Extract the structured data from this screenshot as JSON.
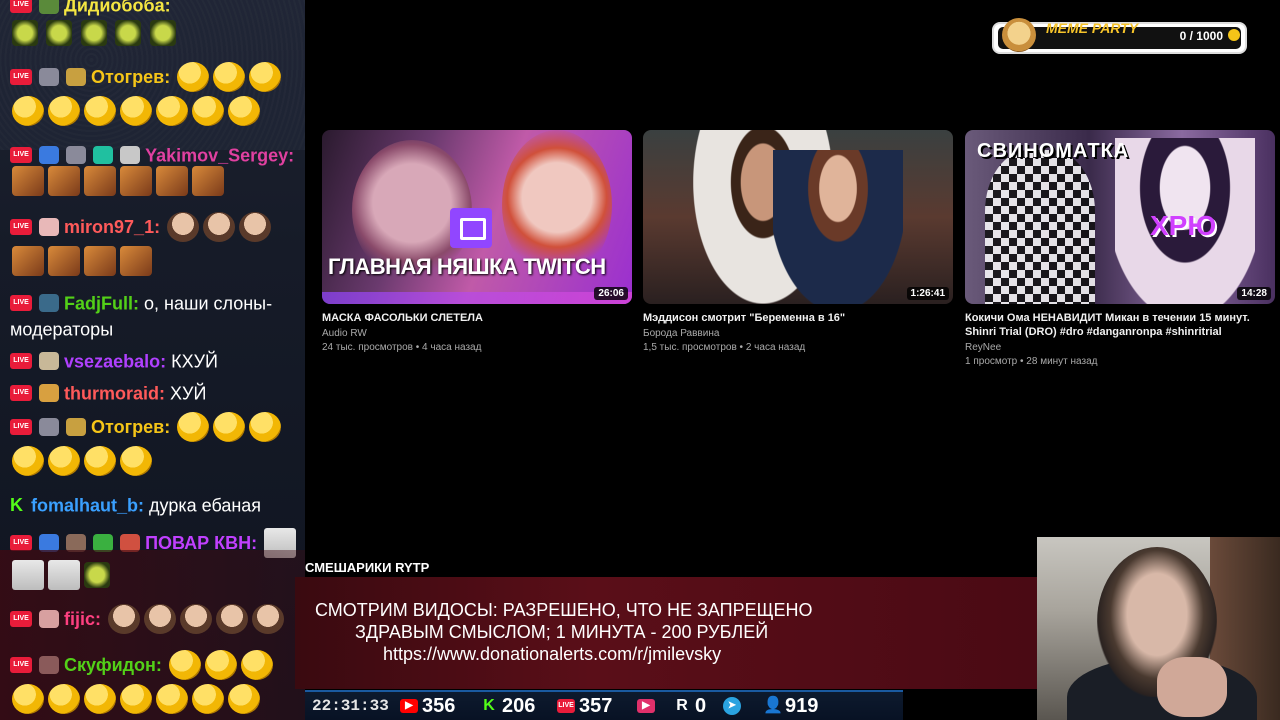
{
  "chat": {
    "messages": [
      {
        "nick": "Дидиобоба:",
        "text": "",
        "color": "#f5e642"
      },
      {
        "nick": "Отогрев:",
        "text": "",
        "color": "#f5c518"
      },
      {
        "nick": "Yakimov_Sergey:",
        "text": "",
        "color": "#e040a0"
      },
      {
        "nick": "miron97_1:",
        "text": "",
        "color": "#ff5a5a"
      },
      {
        "nick": "FadjFull:",
        "text": "о, наши слоны-",
        "text2": "модераторы",
        "color": "#53d018"
      },
      {
        "nick": "vsezaebalo:",
        "text": "КХУЙ",
        "color": "#b040ff"
      },
      {
        "nick": "thurmoraid:",
        "text": "ХУЙ",
        "color": "#ff5a5a"
      },
      {
        "nick": "Отогрев:",
        "text": "",
        "color": "#f5c518"
      },
      {
        "nick": "fomalhaut_b:",
        "text": "дурка ебаная",
        "color": "#3aa0ff"
      },
      {
        "nick": "ПОВАР КВН:",
        "text": "",
        "color": "#c040ff"
      },
      {
        "nick": "fijic:",
        "text": "",
        "color": "#ff4080"
      },
      {
        "nick": "Скуфидон:",
        "text": "",
        "color": "#53d018"
      }
    ]
  },
  "meme_party": {
    "title": "MEME PARTY",
    "count": "0 / 1000"
  },
  "videos": [
    {
      "thumb_text": "ГЛАВНАЯ НЯШКА TWITCH",
      "duration": "26:06",
      "title": "МАСКА ФАСОЛЬКИ СЛЕТЕЛА",
      "channel": "Audio RW",
      "meta": "24 тыс. просмотров • 4 часа назад"
    },
    {
      "thumb_text": "",
      "duration": "1:26:41",
      "title": "Мэддисон смотрит \"Беременна в 16\"",
      "channel": "Борода Раввина",
      "meta": "1,5 тыс. просмотров • 2 часа назад"
    },
    {
      "thumb_text": "СВИНОМАТКА",
      "thumb_text2": "ХРЮ",
      "duration": "14:28",
      "title": "Кокичи Ома НЕНАВИДИТ Микан в течении 15 минут.",
      "title2": "Shinri Trial (DRO) #dro #danganronpa #shinritrial",
      "channel": "ReyNee",
      "meta": "1 просмотр • 28 минут назад"
    }
  ],
  "banner": {
    "title": "СМЕШАРИКИ RYTP",
    "line1": "СМОТРИМ ВИДОСЫ: РАЗРЕШЕНО, ЧТО НЕ ЗАПРЕЩЕНО",
    "line2": "ЗДРАВЫМ СМЫСЛОМ; 1 МИНУТА - 200 РУБЛЕЙ",
    "line3": "https://www.donationalerts.com/r/jmilevsky"
  },
  "stats": {
    "clock": "22:31:33",
    "youtube": "356",
    "kick": "206",
    "live": "357",
    "rutube_icon_count": "",
    "r_count": "0",
    "telegram": "",
    "viewers": "919"
  }
}
